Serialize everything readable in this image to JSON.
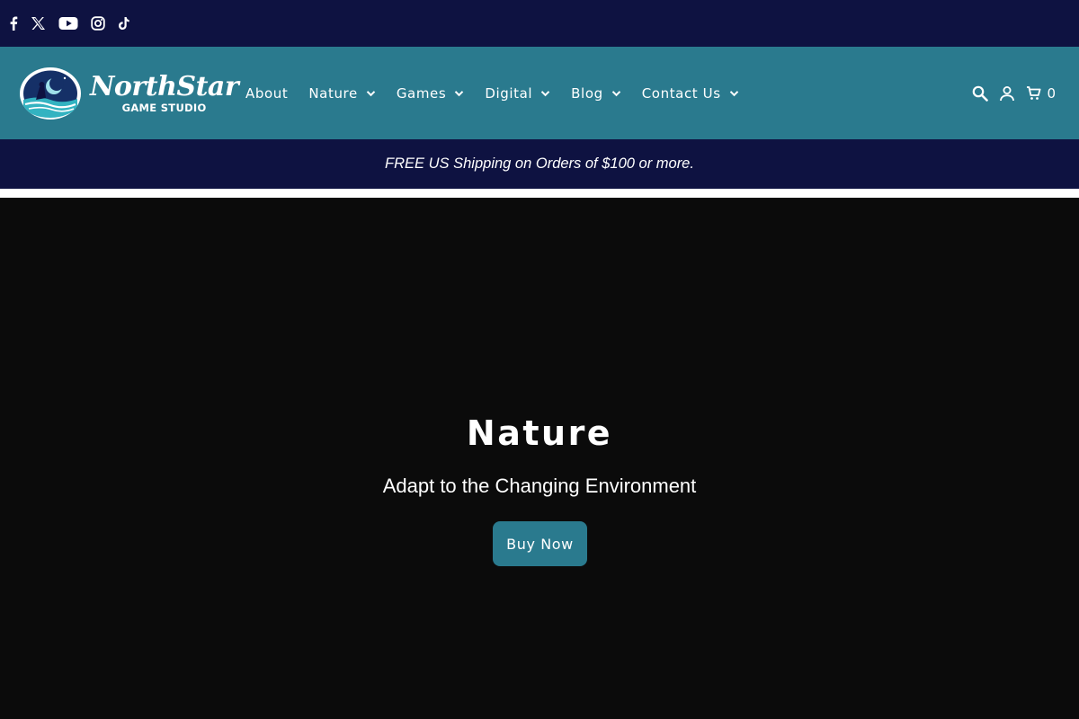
{
  "social": {
    "icons": [
      "facebook-icon",
      "x-twitter-icon",
      "youtube-icon",
      "instagram-icon",
      "tiktok-icon"
    ]
  },
  "header": {
    "logo": {
      "title": "NorthStar",
      "subtitle": "GAME STUDIO"
    },
    "nav": [
      {
        "label": "About",
        "has_dropdown": false
      },
      {
        "label": "Nature",
        "has_dropdown": true
      },
      {
        "label": "Games",
        "has_dropdown": true
      },
      {
        "label": "Digital",
        "has_dropdown": true
      },
      {
        "label": "Blog",
        "has_dropdown": true
      },
      {
        "label": "Contact Us",
        "has_dropdown": true
      }
    ],
    "cart_count": "0",
    "icons": [
      "search-icon",
      "account-icon",
      "cart-icon"
    ]
  },
  "announcement": {
    "text": "FREE US Shipping on Orders of $100 or more."
  },
  "hero": {
    "title": "Nature",
    "subtitle": "Adapt to the Changing Environment",
    "button_label": "Buy Now"
  },
  "colors": {
    "navy": "#0e1241",
    "teal": "#2a7a8e",
    "hero_bg": "#0b0b0b"
  }
}
